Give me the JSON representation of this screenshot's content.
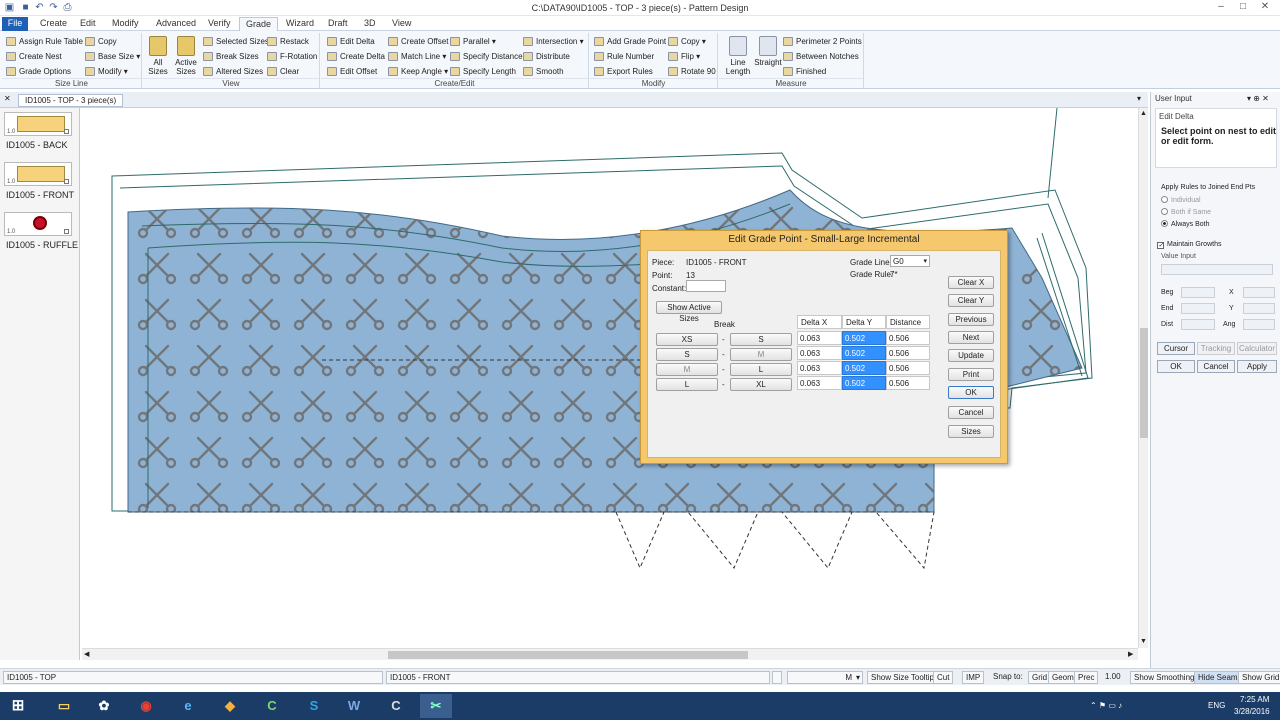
{
  "window": {
    "title": "C:\\DATA90\\ID1005 - TOP  -  3 piece(s)  -  Pattern Design"
  },
  "menu": [
    "File",
    "Create",
    "Edit",
    "Modify",
    "Advanced",
    "Verify",
    "Grade",
    "Wizard",
    "Draft",
    "3D",
    "View"
  ],
  "ribbon": {
    "size_line": {
      "label": "Size Line",
      "items": [
        "Assign Rule Table",
        "Create Nest",
        "Grade Options",
        "Copy",
        "Base Size",
        "Modify"
      ]
    },
    "view": {
      "label": "View",
      "big": [
        "All Sizes",
        "Active Sizes"
      ],
      "items": [
        "Selected Sizes",
        "Break Sizes",
        "Altered Sizes",
        "Restack",
        "F-Rotation",
        "Clear"
      ]
    },
    "create_edit": {
      "label": "Create/Edit",
      "items": [
        "Edit Delta",
        "Create Delta",
        "Edit Offset",
        "Create Offset",
        "Match Line",
        "Keep Angle",
        "Parallel",
        "Specify Distance",
        "Specify Length",
        "Intersection",
        "Distribute",
        "Smooth"
      ]
    },
    "modify": {
      "label": "Modify",
      "items": [
        "Add Grade Point",
        "Rule Number",
        "Export Rules",
        "Copy",
        "Flip",
        "Rotate 90"
      ]
    },
    "measure": {
      "label": "Measure",
      "big": [
        "Line Length",
        "Straight"
      ],
      "items": [
        "Perimeter 2 Points",
        "Between Notches",
        "Finished"
      ]
    }
  },
  "doc_tab": "ID1005 - TOP  -  3 piece(s)",
  "pieces": [
    {
      "name": "ID1005 - BACK",
      "size": "1.0"
    },
    {
      "name": "ID1005 - FRONT",
      "size": "1.0"
    },
    {
      "name": "ID1005 - RUFFLE",
      "size": "1.0"
    }
  ],
  "user_input": {
    "title": "User Input",
    "mode": "Edit Delta",
    "prompt": "Select point on nest to edit or edit form.",
    "apply_rules_label": "Apply Rules to Joined End Pts",
    "radios": [
      {
        "label": "Individual",
        "on": false
      },
      {
        "label": "Both if Same",
        "on": false
      },
      {
        "label": "Always Both",
        "on": true
      }
    ],
    "maintain_growths": "Maintain Growths",
    "value_input": "Value Input",
    "rows": [
      {
        "l": "Beg",
        "r": "X"
      },
      {
        "l": "End",
        "r": "Y"
      },
      {
        "l": "Dist",
        "r": "Ang"
      }
    ],
    "tools": [
      "Cursor",
      "Tracking",
      "Calculator"
    ],
    "buttons": [
      "OK",
      "Cancel",
      "Apply"
    ]
  },
  "dialog": {
    "title": "Edit Grade Point - Small-Large Incremental",
    "piece_label": "Piece:",
    "piece": "ID1005 - FRONT",
    "point_label": "Point:",
    "point": "13",
    "constant_label": "Constant:",
    "grade_line_label": "Grade Line:",
    "grade_line": "G0",
    "grade_rule_label": "Grade Rule:",
    "grade_rule": "7*",
    "show_active": "Show Active Sizes",
    "break_label": "Break",
    "columns": [
      "Delta X",
      "Delta Y",
      "Distance"
    ],
    "rows": [
      {
        "from": "XS",
        "to": "S",
        "dx": "0.063",
        "dy": "0.502",
        "dist": "0.506"
      },
      {
        "from": "S",
        "to": "M",
        "dx": "0.063",
        "dy": "0.502",
        "dist": "0.506"
      },
      {
        "from": "M",
        "to": "L",
        "dx": "0.063",
        "dy": "0.502",
        "dist": "0.506"
      },
      {
        "from": "L",
        "to": "XL",
        "dx": "0.063",
        "dy": "0.502",
        "dist": "0.506"
      }
    ],
    "buttons": [
      "Clear X",
      "Clear Y",
      "Previous",
      "Next",
      "Update",
      "Print",
      "OK",
      "Cancel",
      "Sizes"
    ]
  },
  "status": {
    "left": "ID1005 - TOP",
    "piece": "ID1005 - FRONT",
    "size": "M",
    "buttons": [
      "Show Size Tooltip",
      "Cut",
      "IMP"
    ],
    "snap_label": "Snap to:",
    "snap": [
      "Grid",
      "Geom",
      "Prec"
    ],
    "value": "1.00",
    "right": [
      "Show Smoothing",
      "Hide Seams",
      "Show Grid"
    ]
  },
  "taskbar": {
    "lang": "ENG",
    "time": "7:25 AM",
    "date": "3/28/2016"
  },
  "colors": {
    "fabric": "#8fb3d4",
    "dialog_frame": "#f6c86d",
    "selection": "#3390ff",
    "accent": "#1f5fb4"
  }
}
